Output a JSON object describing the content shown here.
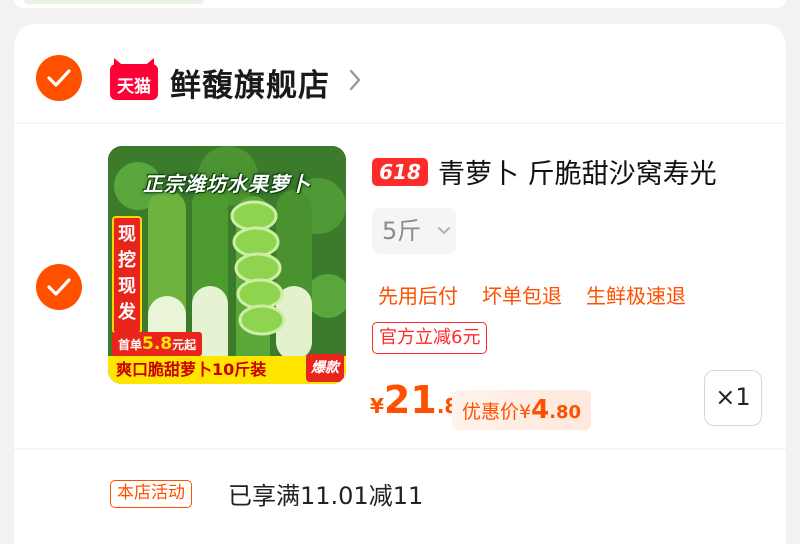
{
  "shop": {
    "platform_label": "天猫",
    "name": "鲜馥旗舰店"
  },
  "item": {
    "image": {
      "headline": "正宗潍坊水果萝卜",
      "vertical_label": "现挖现发",
      "promo_prefix": "首单",
      "promo_price": "5.8",
      "promo_suffix": "元起",
      "bottom_banner": "爽口脆甜萝卜10斤装",
      "hot_label": "爆款"
    },
    "badge": "618",
    "title": "青萝卜 斤脆甜沙窝寿光",
    "sku_value": "5斤",
    "service_tags": [
      "先用后付",
      "坏单包退",
      "生鲜极速退"
    ],
    "coupon": "官方立减6元",
    "price": {
      "symbol": "¥",
      "integer": "21",
      "decimal": ".8"
    },
    "discount": {
      "label": "优惠价¥",
      "integer": "4",
      "decimal": ".80"
    },
    "quantity": "×1"
  },
  "store_promo": {
    "tag": "本店活动",
    "text": "已享满11.01减11"
  },
  "colors": {
    "accent": "#ff5000",
    "tmall_red": "#ff0036",
    "background": "#f2f2f2"
  },
  "icons": {
    "check": "check-icon",
    "chevron_right": "chevron-right-icon",
    "chevron_down": "chevron-down-icon"
  }
}
